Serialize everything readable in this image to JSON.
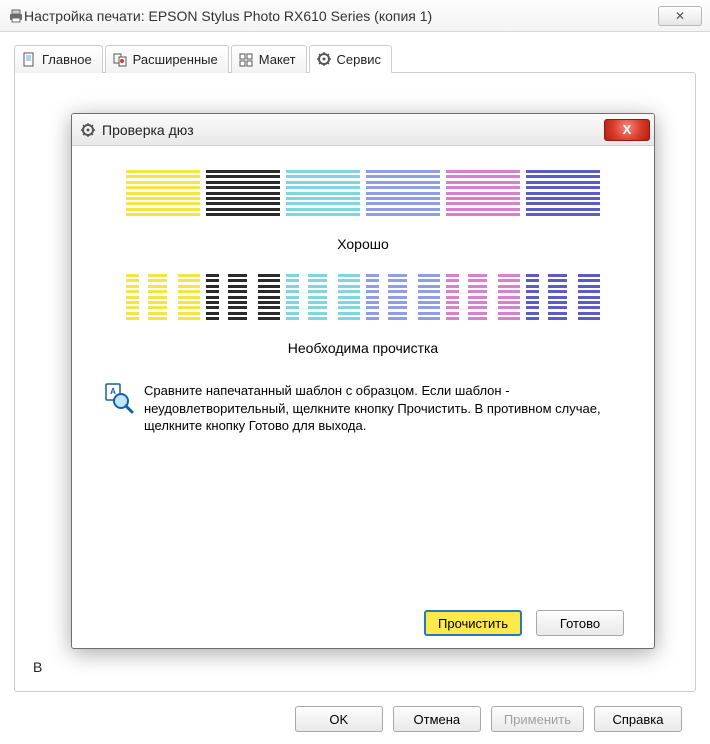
{
  "window": {
    "title": "Настройка печати: EPSON Stylus Photo RX610 Series (копия 1)"
  },
  "tabs": [
    {
      "label": "Главное"
    },
    {
      "label": "Расширенные"
    },
    {
      "label": "Макет"
    },
    {
      "label": "Сервис"
    }
  ],
  "buttons": {
    "ok": "OK",
    "cancel": "Отмена",
    "apply": "Применить",
    "help": "Справка"
  },
  "dialog": {
    "title": "Проверка дюз",
    "good_label": "Хорошо",
    "bad_label": "Необходима прочистка",
    "instruction": "Сравните напечатанный шаблон с образцом. Если шаблон - неудовлетворительный, щелкните кнопку Прочистить. В противном случае, щелкните кнопку Готово для выхода.",
    "clean_btn": "Прочистить",
    "done_btn": "Готово"
  },
  "pattern_colors": [
    "#f4e542",
    "#2b2b2b",
    "#7fd6e0",
    "#8f9ee6",
    "#d97fd0",
    "#5c5cc9"
  ],
  "peek": "В"
}
